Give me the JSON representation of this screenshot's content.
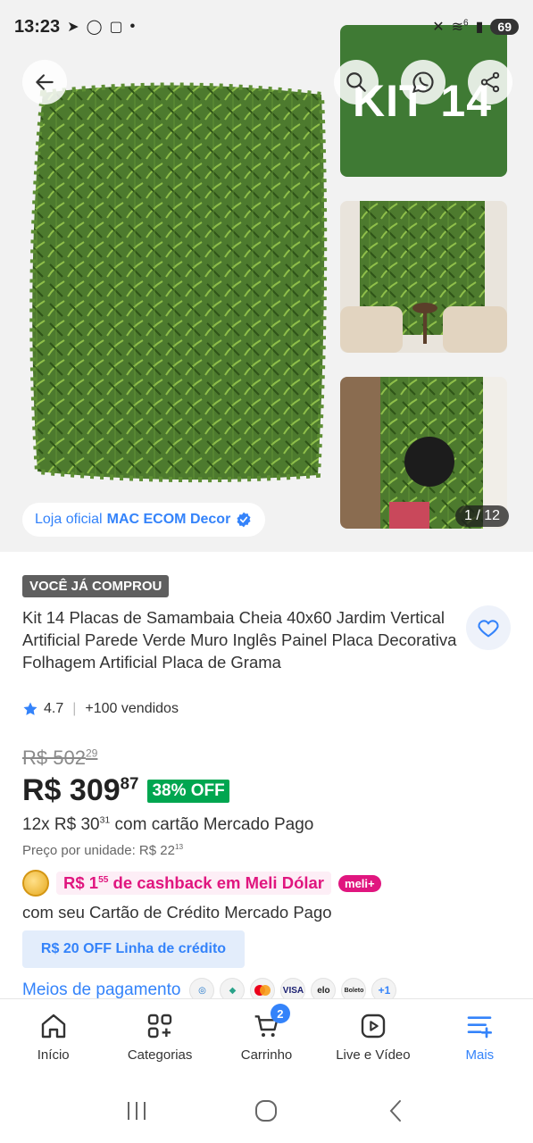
{
  "status_bar": {
    "time": "13:23",
    "battery": "69",
    "signal_badge": "6"
  },
  "gallery": {
    "thumb1_text": "KIT 14",
    "counter": "1 / 12",
    "store_prefix": "Loja oficial",
    "store_name": "MAC ECOM Decor"
  },
  "product": {
    "bought_badge": "VOCÊ JÁ COMPROU",
    "title": "Kit 14 Placas de Samambaia Cheia 40x60 Jardim Vertical Artificial Parede Verde Muro Inglês Painel Placa Decorativa Folhagem Artificial Placa de Grama",
    "rating": "4.7",
    "sold": "+100 vendidos"
  },
  "pricing": {
    "old_price_int": "R$ 502",
    "old_price_cents": "29",
    "price_int": "R$ 309",
    "price_cents": "87",
    "discount": "38% OFF",
    "installments_prefix": "12x R$ 30",
    "installments_cents": "31",
    "installments_suffix": "com cartão Mercado Pago",
    "unit_price_label": "Preço por unidade: R$ 22",
    "unit_price_cents": "13",
    "cashback_prefix": "R$ 1",
    "cashback_cents": "55",
    "cashback_suffix": "de cashback em Meli Dólar",
    "meli_badge": "meli+",
    "credit_card_note": "com seu Cartão de Crédito Mercado Pago",
    "credit_line_button": "R$ 20 OFF Linha de crédito",
    "payment_methods_link": "Meios de pagamento",
    "payment_icons": [
      "pm-icon-1",
      "pm-icon-2",
      "mastercard",
      "VISA",
      "elo",
      "Boleto"
    ],
    "payment_more": "+1"
  },
  "tab_bar": {
    "items": [
      {
        "label": "Início",
        "icon": "home-icon"
      },
      {
        "label": "Categorias",
        "icon": "categories-icon"
      },
      {
        "label": "Carrinho",
        "icon": "cart-icon"
      },
      {
        "label": "Live e Vídeo",
        "icon": "play-icon"
      },
      {
        "label": "Mais",
        "icon": "menu-icon"
      }
    ],
    "cart_count": "2"
  },
  "colors": {
    "accent": "#3483fa",
    "discount_green": "#00a650",
    "cashback_pink": "#e0167f",
    "badge_gray": "#5f5f5f"
  }
}
